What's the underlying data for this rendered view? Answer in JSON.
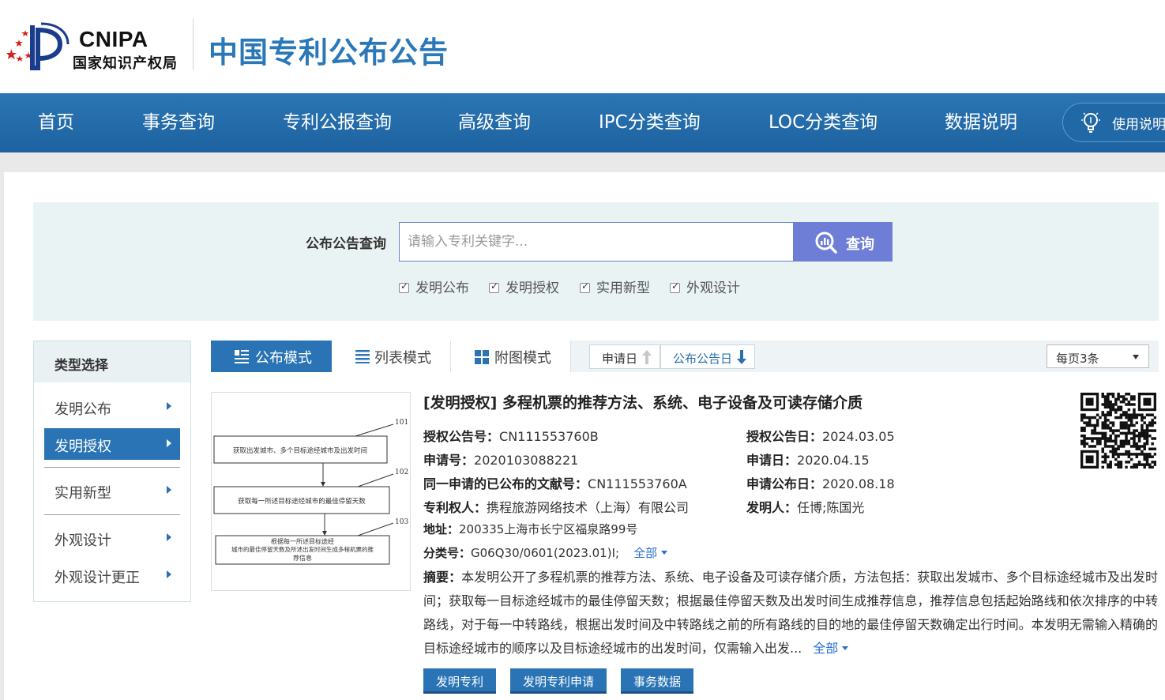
{
  "header": {
    "logo_text": "CNIPA",
    "logo_sub": "国家知识产权局",
    "site_title": "中国专利公布公告"
  },
  "nav": {
    "items": [
      "首页",
      "事务查询",
      "专利公报查询",
      "高级查询",
      "IPC分类查询",
      "LOC分类查询",
      "数据说明"
    ],
    "help_label": "使用说明",
    "help_icon": "lightbulb-icon"
  },
  "search": {
    "label": "公布公告查询",
    "placeholder": "请输入专利关键字...",
    "value": "",
    "button_label": "查询",
    "button_icon": "search-icon",
    "checkboxes": [
      {
        "label": "发明公布",
        "checked": true
      },
      {
        "label": "发明授权",
        "checked": true
      },
      {
        "label": "实用新型",
        "checked": true
      },
      {
        "label": "外观设计",
        "checked": true
      }
    ]
  },
  "type_panel": {
    "title": "类型选择",
    "items": [
      {
        "label": "发明公布",
        "active": false
      },
      {
        "label": "发明授权",
        "active": true
      },
      {
        "label": "实用新型",
        "active": false
      },
      {
        "label": "外观设计",
        "active": false
      },
      {
        "label": "外观设计更正",
        "active": false
      }
    ]
  },
  "toolbar": {
    "modes": [
      {
        "label": "公布模式",
        "icon": "list-detail-icon",
        "active": true
      },
      {
        "label": "列表模式",
        "icon": "list-icon",
        "active": false
      },
      {
        "label": "附图模式",
        "icon": "grid-icon",
        "active": false
      }
    ],
    "sort": [
      {
        "label": "申请日",
        "direction": "up",
        "active": false
      },
      {
        "label": "公布公告日",
        "direction": "down",
        "active": true
      }
    ],
    "per_page": "每页3条"
  },
  "result": {
    "title": "[发明授权] 多程机票的推荐方法、系统、电子设备及可读存储介质",
    "fields": {
      "grant_no_label": "授权公告号：",
      "grant_no": "CN111553760B",
      "grant_date_label": "授权公告日：",
      "grant_date": "2024.03.05",
      "app_no_label": "申请号：",
      "app_no": "2020103088221",
      "app_date_label": "申请日：",
      "app_date": "2020.04.15",
      "related_label": "同一申请的已公布的文献号：",
      "related": "CN111553760A",
      "pub_date_label": "申请公布日：",
      "pub_date": "2020.08.18",
      "patentee_label": "专利权人：",
      "patentee": "携程旅游网络技术（上海）有限公司",
      "inventor_label": "发明人：",
      "inventor": "任博;陈国光",
      "address_label": "地址：",
      "address": "200335上海市长宁区福泉路99号",
      "class_label": "分类号：",
      "class": "G06Q30/0601(2023.01)I;",
      "class_more": "全部"
    },
    "abstract_label": "摘要：",
    "abstract": "本发明公开了多程机票的推荐方法、系统、电子设备及可读存储介质，方法包括：获取出发城市、多个目标途经城市及出发时间；获取每一目标途经城市的最佳停留天数；根据最佳停留天数及出发时间生成推荐信息，推荐信息包括起始路线和依次排序的中转路线，对于每一中转路线，根据出发时间及中转路线之前的所有路线的目的地的最佳停留天数确定出行时间。本发明无需输入精确的目标途经城市的顺序以及目标途经城市的出发时间，仅需输入出发...",
    "abstract_more": "全部",
    "buttons": [
      "发明专利",
      "发明专利申请",
      "事务数据"
    ],
    "drawing": {
      "steps": [
        "获取出发城市、多个目标途经城市及出发时间",
        "获取每一所述目标途经城市的最佳停留天数",
        "根据每一所述目标途经",
        "城市的最佳停留天数及所述出发时间生成多程机票的推",
        "荐信息"
      ],
      "step_numbers": [
        "101",
        "102",
        "103"
      ]
    }
  }
}
